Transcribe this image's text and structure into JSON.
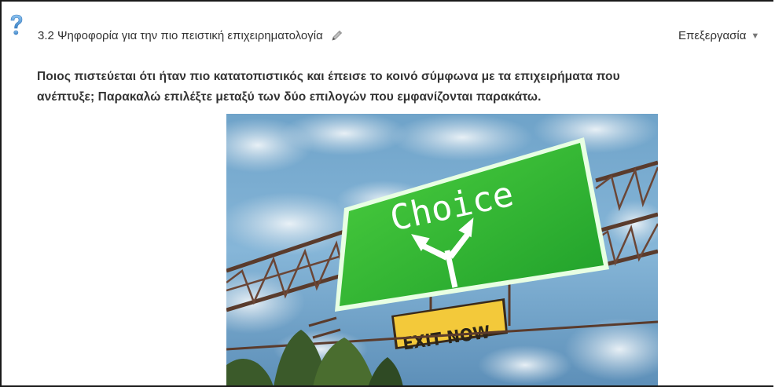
{
  "question_header": {
    "title": "3.2 Ψηφοφορία για την πιο πειστική επιχειρηματολογία",
    "edit_label": "Επεξεργασία",
    "icons": {
      "help": "question-mark-icon",
      "edit": "pencil-icon",
      "dropdown": "caret-down-icon"
    }
  },
  "question_body": {
    "line1": "Ποιος πιστεύεται ότι ήταν πιο κατατοπιστικός και έπεισε το κοινό σύμφωνα με τα επιχειρήματα που",
    "line2": "ανέπτυξε; Παρακαλώ επιλέξτε μεταξύ των δύο επιλογών που εμφανίζονται παρακάτω."
  },
  "illustration": {
    "sign_text": "Choice",
    "exit_text": "EXIT NOW"
  },
  "colors": {
    "text": "#333333",
    "help_icon": "#5b9bd5",
    "sign_green": "#2fb82f",
    "exit_yellow": "#f3c93a"
  }
}
